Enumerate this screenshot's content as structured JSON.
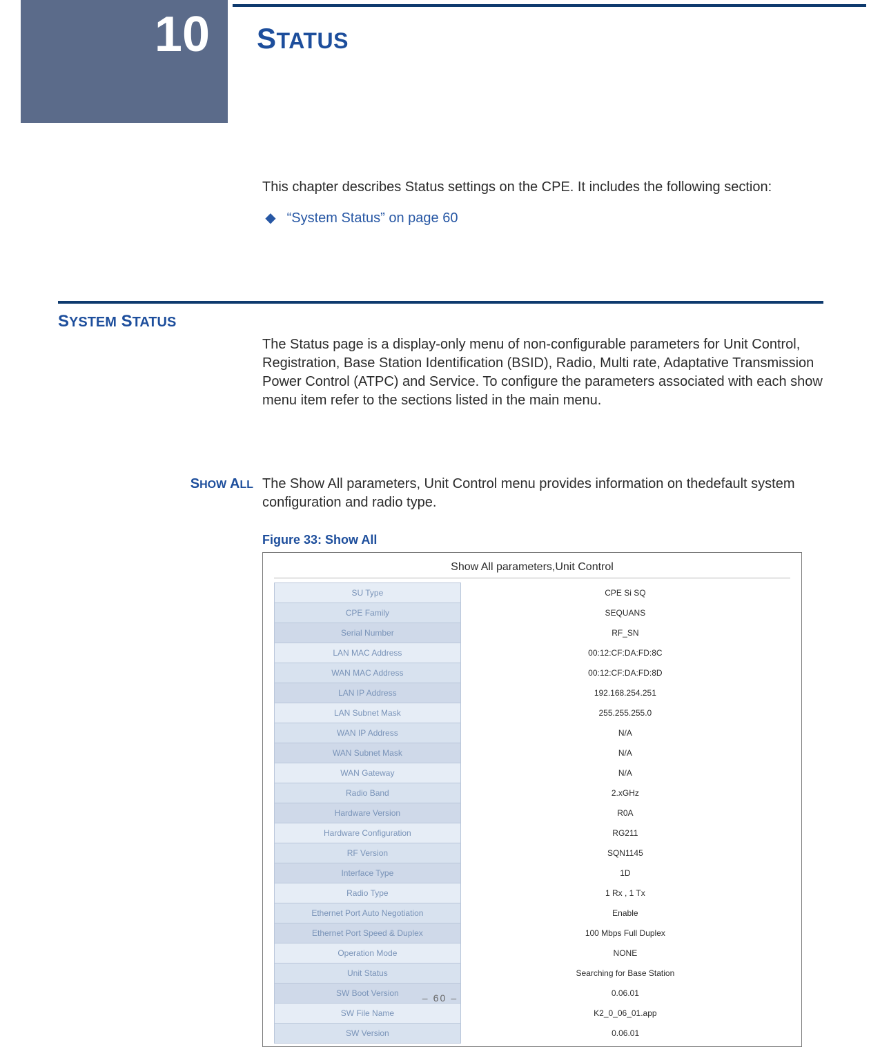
{
  "chapter": {
    "number": "10",
    "title_big": "S",
    "title_rest": "TATUS"
  },
  "intro": {
    "para": "This chapter describes Status settings on the CPE. It includes the following section:",
    "bullet_text": "“System Status” on page 60"
  },
  "section": {
    "label_big": "S",
    "label1_rest": "YSTEM",
    "label_big2": "S",
    "label2_rest": "TATUS",
    "para": "The Status page is a display-only menu of non-configurable parameters for Unit Control, Registration, Base Station Identification (BSID), Radio, Multi rate, Adaptative Transmission Power Control (ATPC) and Service. To configure the parameters associated with each show menu item refer to the sections listed in the main menu."
  },
  "showall": {
    "label_big": "S",
    "label1_rest": "HOW",
    "label_big2": "A",
    "label2_rest": "LL",
    "para": "The Show All parameters, Unit Control menu provides information on thedefault system configuration and radio type.",
    "figure_caption": "Figure 33:  Show All",
    "panel_title": "Show All parameters,Unit Control",
    "rows": [
      {
        "k": "SU Type",
        "v": "CPE Si SQ"
      },
      {
        "k": "CPE Family",
        "v": "SEQUANS"
      },
      {
        "k": "Serial Number",
        "v": "RF_SN"
      },
      {
        "k": "LAN MAC Address",
        "v": "00:12:CF:DA:FD:8C"
      },
      {
        "k": "WAN MAC Address",
        "v": "00:12:CF:DA:FD:8D"
      },
      {
        "k": "LAN IP Address",
        "v": "192.168.254.251"
      },
      {
        "k": "LAN Subnet Mask",
        "v": "255.255.255.0"
      },
      {
        "k": "WAN IP Address",
        "v": "N/A"
      },
      {
        "k": "WAN Subnet Mask",
        "v": "N/A"
      },
      {
        "k": "WAN Gateway",
        "v": "N/A"
      },
      {
        "k": "Radio Band",
        "v": "2.xGHz"
      },
      {
        "k": "Hardware Version",
        "v": "R0A"
      },
      {
        "k": "Hardware Configuration",
        "v": "RG211"
      },
      {
        "k": "RF Version",
        "v": "SQN1145"
      },
      {
        "k": "Interface Type",
        "v": "1D"
      },
      {
        "k": "Radio Type",
        "v": "1 Rx , 1 Tx"
      },
      {
        "k": "Ethernet Port Auto Negotiation",
        "v": "Enable"
      },
      {
        "k": "Ethernet Port Speed & Duplex",
        "v": "100 Mbps Full Duplex"
      },
      {
        "k": "Operation Mode",
        "v": "NONE"
      },
      {
        "k": "Unit Status",
        "v": "Searching for Base Station"
      },
      {
        "k": "SW Boot Version",
        "v": "0.06.01"
      },
      {
        "k": "SW File Name",
        "v": "K2_0_06_01.app"
      },
      {
        "k": "SW Version",
        "v": "0.06.01"
      }
    ]
  },
  "footer": "–  60  –"
}
